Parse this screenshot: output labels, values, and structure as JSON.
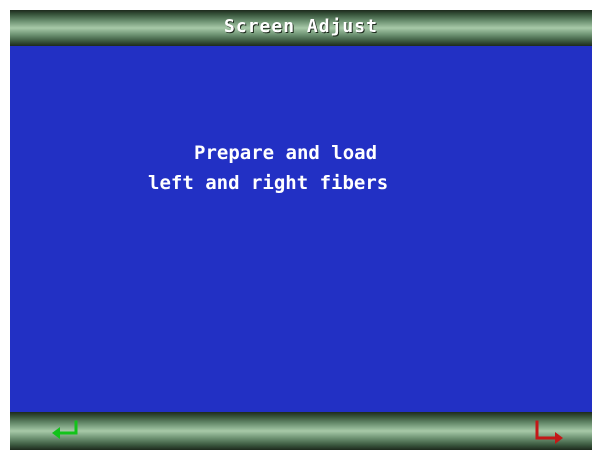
{
  "title": "Screen Adjust",
  "message": {
    "line1": "Prepare and load",
    "line2": "left and right fibers"
  },
  "footer": {
    "left_icon": "enter-return-arrow-icon",
    "left_icon_color": "#12c31a",
    "right_icon": "exit-arrow-icon",
    "right_icon_color": "#c41818"
  },
  "colors": {
    "background": "#2230c4",
    "text": "#ffffff"
  }
}
